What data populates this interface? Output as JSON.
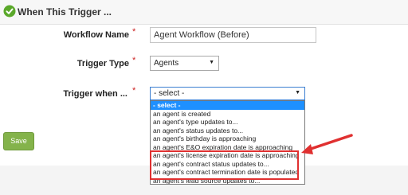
{
  "header": {
    "title": "When This Trigger ..."
  },
  "form": {
    "workflow_name": {
      "label": "Workflow Name",
      "required": "*",
      "value": "Agent Workflow (Before)"
    },
    "trigger_type": {
      "label": "Trigger Type",
      "required": "*",
      "value": "Agents"
    },
    "trigger_when": {
      "label": "Trigger when ...",
      "required": "*",
      "value": "- select -",
      "options": [
        "- select -",
        "an agent is created",
        "an agent's type updates to...",
        "an agent's status updates to...",
        "an agent's birthday is approaching",
        "an agent's E&O expiration date is approaching",
        "an agent's license expiration date is approaching",
        "an agent's contract status updates to...",
        "an agent's contract termination date is populated",
        "an agent's lead source updates to..."
      ],
      "selected_index": 0,
      "highlighted_options": [
        6,
        7,
        8
      ]
    }
  },
  "buttons": {
    "save": "Save"
  },
  "colors": {
    "accent_green": "#84b34b",
    "highlight_red": "#e03030",
    "selected_blue": "#1e90ff",
    "check_green": "#5aa82a"
  },
  "icons": {
    "header": "check-circle-icon",
    "annotation": "red-arrow-icon"
  }
}
